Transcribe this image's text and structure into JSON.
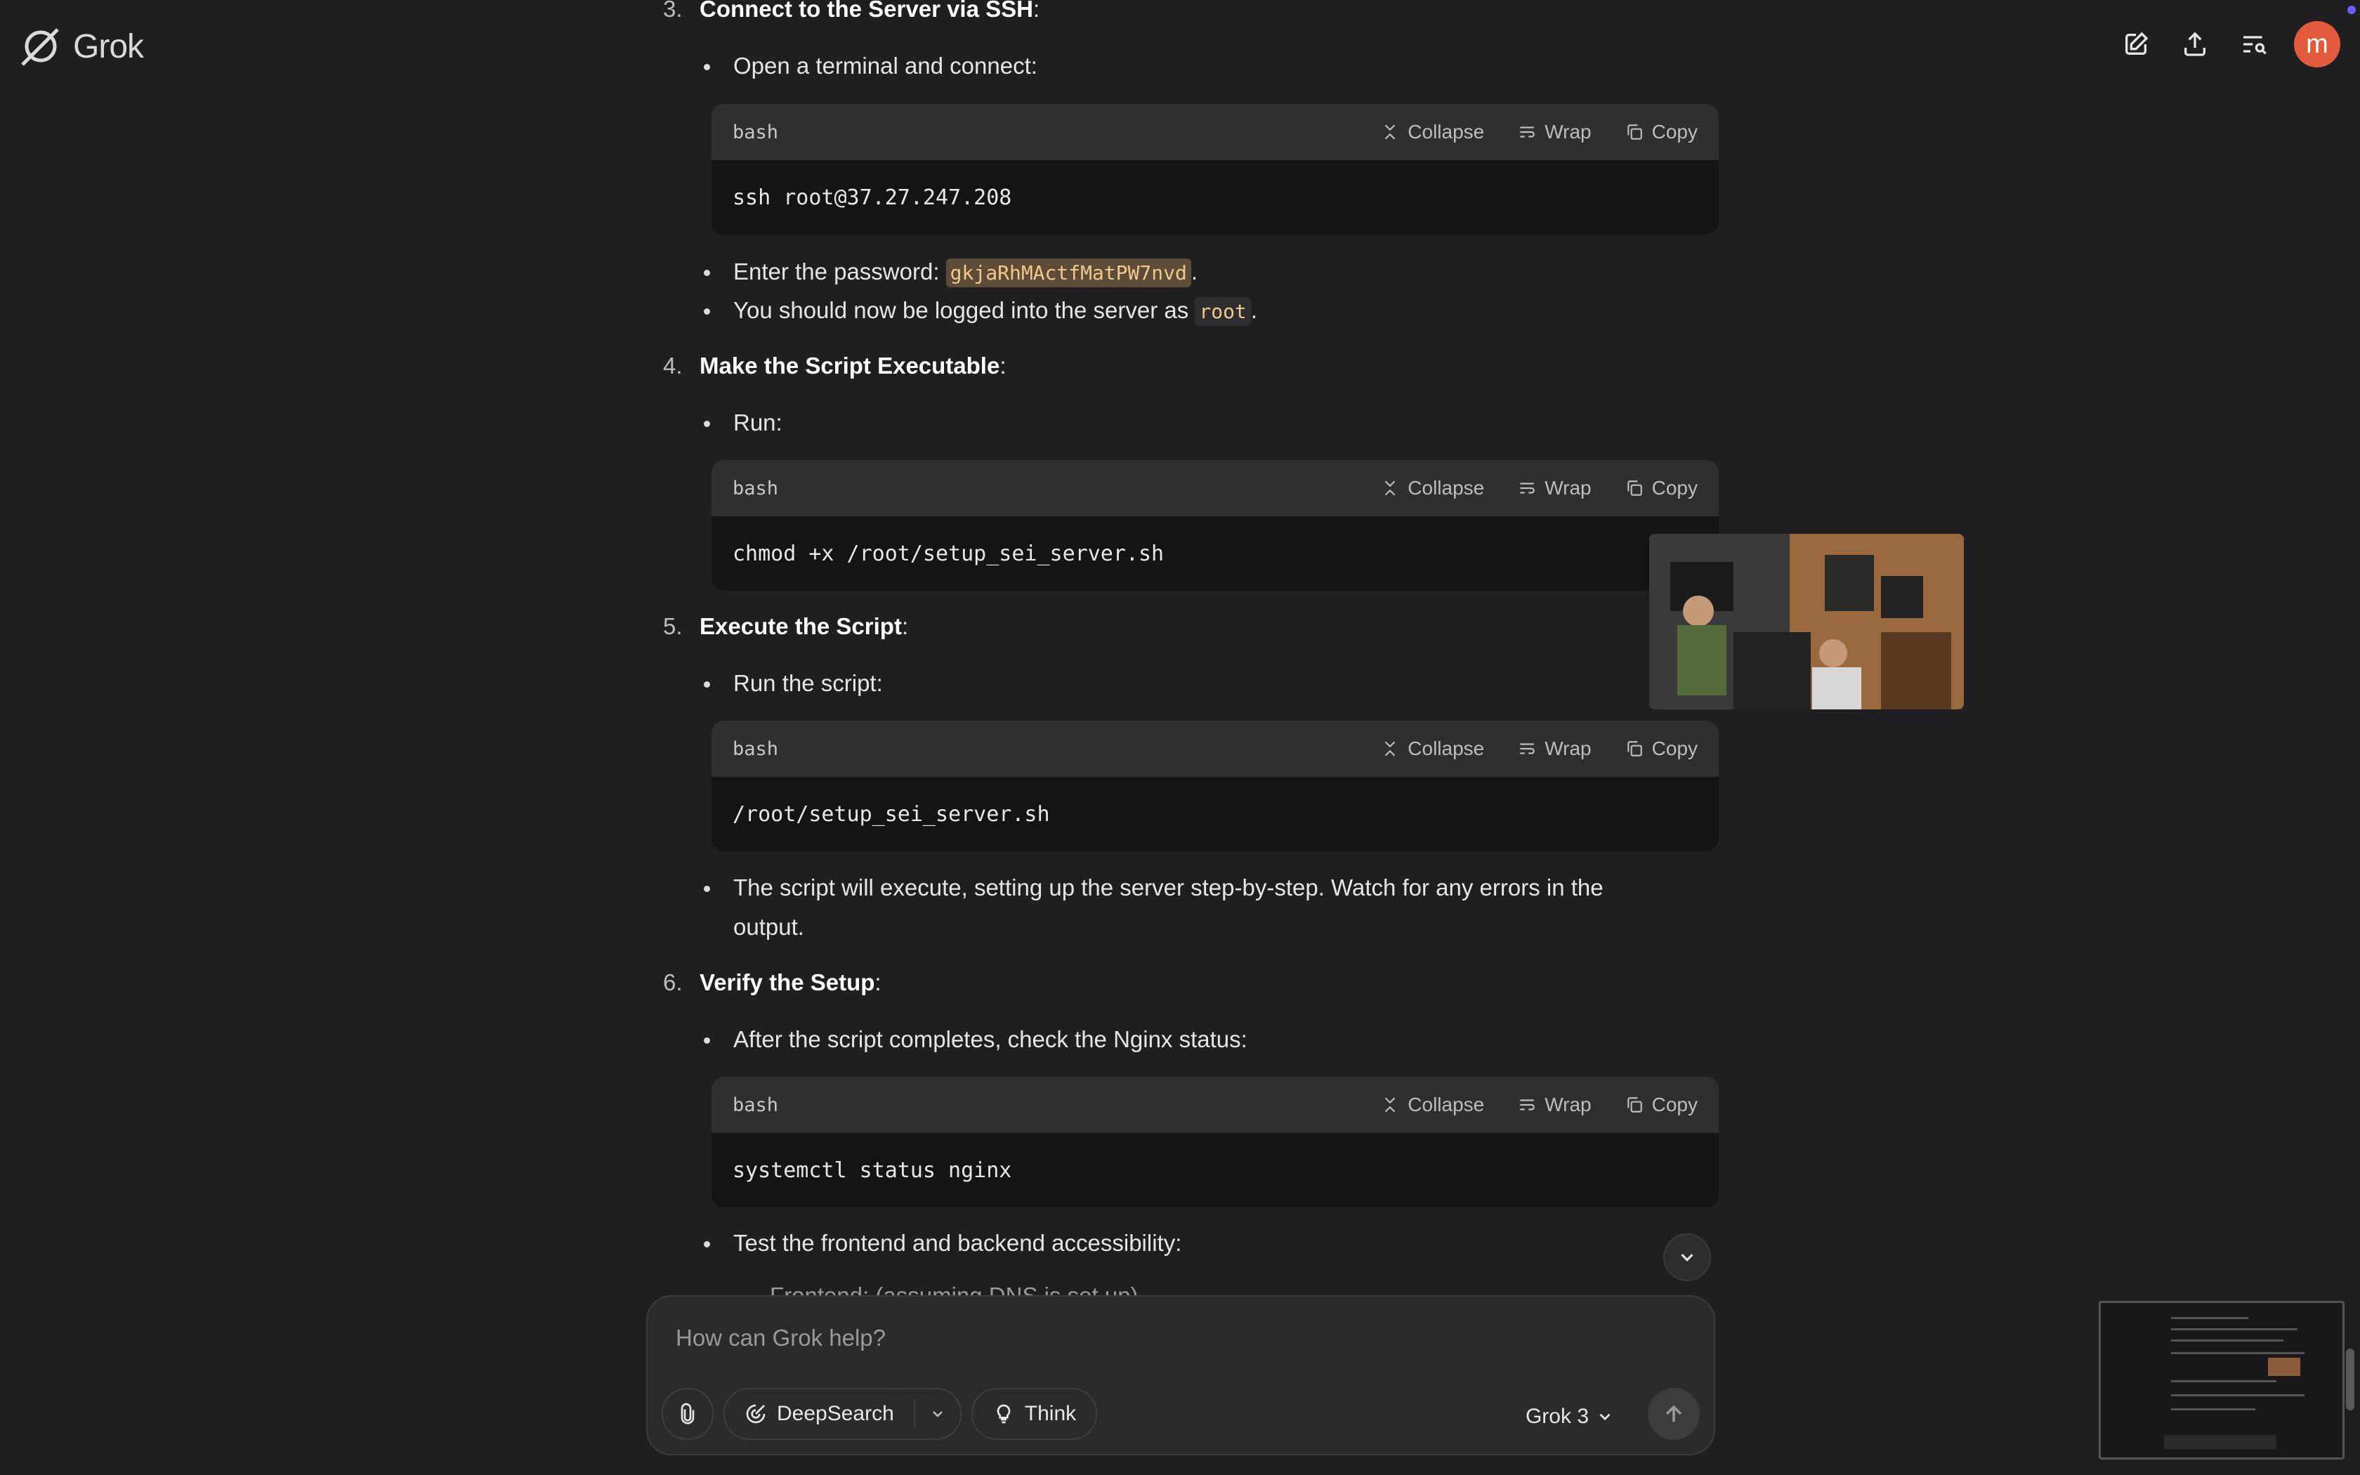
{
  "app": {
    "name": "Grok",
    "avatar_initial": "m"
  },
  "steps": [
    {
      "number": "3.",
      "title": "Connect to the Server via SSH",
      "suffix": ":"
    },
    {
      "number": "4.",
      "title": "Make the Script Executable",
      "suffix": ":"
    },
    {
      "number": "5.",
      "title": "Execute the Script",
      "suffix": ":"
    },
    {
      "number": "6.",
      "title": "Verify the Setup",
      "suffix": ":"
    }
  ],
  "bullets": {
    "open_terminal": "Open a terminal and connect:",
    "enter_password": "Enter the password:",
    "password_value": "gkjaRhMActfMatPW7nvd",
    "logged_in_prefix": "You should now be logged into the server as",
    "logged_in_user": "root",
    "run": "Run:",
    "run_script": "Run the script:",
    "script_will_execute": "The script will execute, setting up the server step-by-step. Watch for any errors in the output.",
    "after_script": "After the script completes, check the Nginx status:",
    "test_access": "Test the frontend and backend accessibility:"
  },
  "code_blocks": [
    {
      "lang": "bash",
      "code": "ssh root@37.27.247.208"
    },
    {
      "lang": "bash",
      "code": "chmod +x /root/setup_sei_server.sh"
    },
    {
      "lang": "bash",
      "code": "/root/setup_sei_server.sh"
    },
    {
      "lang": "bash",
      "code": "systemctl status nginx"
    }
  ],
  "code_actions": {
    "collapse": "Collapse",
    "wrap": "Wrap",
    "copy": "Copy"
  },
  "partial_line": "Frontend:  (assuming DNS is set up)",
  "composer": {
    "placeholder": "How can Grok help?",
    "deepsearch_label": "DeepSearch",
    "think_label": "Think",
    "model_label": "Grok 3"
  },
  "icons": [
    "grok-logo-icon",
    "new-chat-icon",
    "share-icon",
    "search-history-icon",
    "collapse-icon",
    "wrap-icon",
    "copy-icon",
    "chevron-down-icon",
    "paperclip-icon",
    "deepsearch-icon",
    "lightbulb-icon",
    "send-arrow-icon"
  ],
  "colors": {
    "background": "#1f1f21",
    "avatar": "#e15b3c",
    "inline_code": "#f0c98a"
  }
}
